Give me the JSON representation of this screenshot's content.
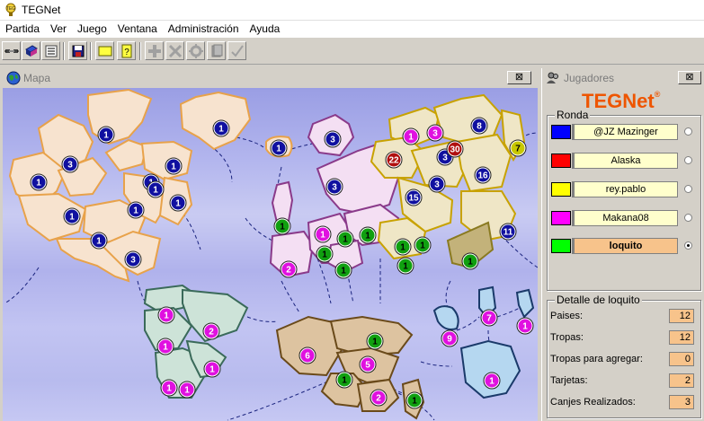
{
  "app": {
    "title": "TEGNet"
  },
  "menu": [
    {
      "label": "Partida"
    },
    {
      "label": "Ver"
    },
    {
      "label": "Juego"
    },
    {
      "label": "Ventana"
    },
    {
      "label": "Administración"
    },
    {
      "label": "Ayuda"
    }
  ],
  "toolbar": {
    "icons": [
      "connect-icon",
      "server-icon",
      "list-icon",
      "save-icon",
      "card-yellow-icon",
      "card-question-icon",
      "add-armies-icon",
      "attack-icon",
      "regroup-icon",
      "cards-icon",
      "done-icon"
    ]
  },
  "map_window": {
    "title": "Mapa",
    "close": "⊠"
  },
  "players_window": {
    "title": "Jugadores",
    "close": "⊠",
    "logo": {
      "teg": "TEG",
      "net": "Net",
      "reg": "®"
    },
    "round_label": "Ronda",
    "players": [
      {
        "name": "@JZ Mazinger",
        "color": "#0000ff",
        "selected": false,
        "highlight": false
      },
      {
        "name": "Alaska",
        "color": "#ff0000",
        "selected": false,
        "highlight": false
      },
      {
        "name": "rey.pablo",
        "color": "#ffff00",
        "selected": false,
        "highlight": false
      },
      {
        "name": "Makana08",
        "color": "#ff00ff",
        "selected": false,
        "highlight": false
      },
      {
        "name": "loquito",
        "color": "#00ff00",
        "selected": true,
        "highlight": true
      }
    ],
    "detail_label": "Detalle de loquito",
    "stats": [
      {
        "label": "Paises:",
        "value": "12"
      },
      {
        "label": "Tropas:",
        "value": "12"
      },
      {
        "label": "Tropas para agregar:",
        "value": "0"
      },
      {
        "label": "Tarjetas:",
        "value": "2"
      },
      {
        "label": "Canjes Realizados:",
        "value": "3"
      }
    ]
  },
  "colors": {
    "blue_player": "#1010a0",
    "red_player": "#b01010",
    "yellow_player": "#c8c800",
    "magenta_player": "#e010e0",
    "green_player": "#10a010",
    "north_america": "#f7e3cf",
    "south_america": "#cde3d8",
    "europe": "#f4dff3",
    "asia": "#efe6c6",
    "africa": "#ddc3a0",
    "oceania": "#b5d7f0"
  },
  "armies": [
    {
      "v": "1",
      "c": "blue"
    },
    {
      "v": "1",
      "c": "blue"
    },
    {
      "v": "1",
      "c": "blue"
    },
    {
      "v": "3",
      "c": "blue"
    },
    {
      "v": "1",
      "c": "blue"
    },
    {
      "v": "1",
      "c": "blue"
    },
    {
      "v": "1",
      "c": "blue"
    },
    {
      "v": "1",
      "c": "blue"
    },
    {
      "v": "1",
      "c": "blue"
    },
    {
      "v": "1",
      "c": "blue"
    },
    {
      "v": "1",
      "c": "blue"
    },
    {
      "v": "3",
      "c": "blue"
    },
    {
      "v": "1",
      "c": "blue"
    },
    {
      "v": "3",
      "c": "blue"
    },
    {
      "v": "3",
      "c": "blue"
    },
    {
      "v": "15",
      "c": "blue"
    },
    {
      "v": "3",
      "c": "blue"
    },
    {
      "v": "3",
      "c": "blue"
    },
    {
      "v": "8",
      "c": "blue"
    },
    {
      "v": "16",
      "c": "blue"
    },
    {
      "v": "11",
      "c": "blue"
    },
    {
      "v": "1",
      "c": "magenta"
    },
    {
      "v": "3",
      "c": "magenta"
    },
    {
      "v": "22",
      "c": "red"
    },
    {
      "v": "30",
      "c": "red"
    },
    {
      "v": "7",
      "c": "yellow"
    },
    {
      "v": "1",
      "c": "green"
    },
    {
      "v": "1",
      "c": "green"
    },
    {
      "v": "1",
      "c": "green"
    },
    {
      "v": "1",
      "c": "green"
    },
    {
      "v": "1",
      "c": "green"
    },
    {
      "v": "2",
      "c": "magenta"
    },
    {
      "v": "1",
      "c": "magenta"
    },
    {
      "v": "1",
      "c": "green"
    },
    {
      "v": "1",
      "c": "green"
    },
    {
      "v": "1",
      "c": "green"
    },
    {
      "v": "1",
      "c": "green"
    },
    {
      "v": "1",
      "c": "magenta"
    },
    {
      "v": "2",
      "c": "magenta"
    },
    {
      "v": "1",
      "c": "magenta"
    },
    {
      "v": "1",
      "c": "magenta"
    },
    {
      "v": "1",
      "c": "magenta"
    },
    {
      "v": "1",
      "c": "magenta"
    },
    {
      "v": "6",
      "c": "magenta"
    },
    {
      "v": "1",
      "c": "green"
    },
    {
      "v": "5",
      "c": "magenta"
    },
    {
      "v": "1",
      "c": "green"
    },
    {
      "v": "2",
      "c": "magenta"
    },
    {
      "v": "1",
      "c": "green"
    },
    {
      "v": "9",
      "c": "magenta"
    },
    {
      "v": "7",
      "c": "magenta"
    },
    {
      "v": "1",
      "c": "magenta"
    },
    {
      "v": "1",
      "c": "magenta"
    }
  ]
}
